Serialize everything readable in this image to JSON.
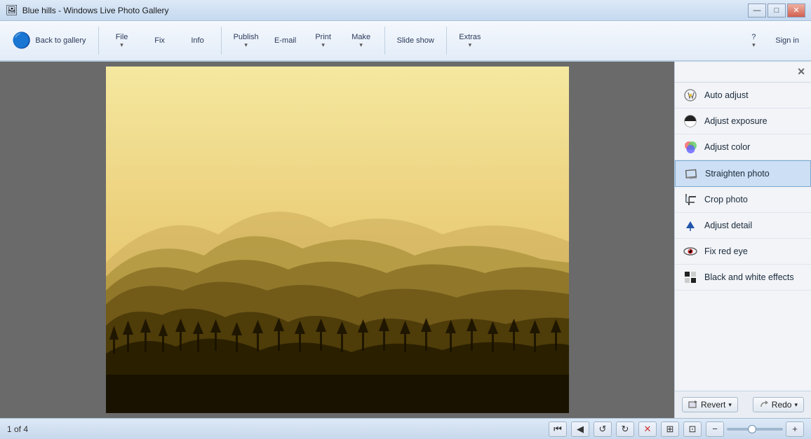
{
  "titlebar": {
    "title": "Blue hills - Windows Live Photo Gallery",
    "icon": "🖼",
    "controls": {
      "minimize": "—",
      "maximize": "□",
      "close": "✕"
    }
  },
  "toolbar": {
    "back_label": "Back to gallery",
    "file_label": "File",
    "fix_label": "Fix",
    "info_label": "Info",
    "publish_label": "Publish",
    "email_label": "E-mail",
    "print_label": "Print",
    "make_label": "Make",
    "slideshow_label": "Slide show",
    "extras_label": "Extras",
    "help_label": "?",
    "signin_label": "Sign in"
  },
  "panel": {
    "close_label": "✕",
    "items": [
      {
        "id": "auto-adjust",
        "label": "Auto adjust",
        "icon": "⚡"
      },
      {
        "id": "adjust-exposure",
        "label": "Adjust exposure",
        "icon": "◑"
      },
      {
        "id": "adjust-color",
        "label": "Adjust color",
        "icon": "🎨"
      },
      {
        "id": "straighten-photo",
        "label": "Straighten photo",
        "icon": "↗"
      },
      {
        "id": "crop-photo",
        "label": "Crop photo",
        "icon": "⊡"
      },
      {
        "id": "adjust-detail",
        "label": "Adjust detail",
        "icon": "▼"
      },
      {
        "id": "fix-red-eye",
        "label": "Fix red eye",
        "icon": "👁"
      },
      {
        "id": "black-white",
        "label": "Black and white effects",
        "icon": "⊞"
      }
    ],
    "footer": {
      "revert_label": "Revert",
      "redo_label": "Redo"
    }
  },
  "bottombar": {
    "photo_count": "1 of 4",
    "nav": {
      "first": "⏮",
      "prev": "◀",
      "ccw": "↺",
      "cw": "↻",
      "delete": "✕",
      "display": "⊞",
      "actual_size": "⊡",
      "zoom_out": "−",
      "zoom_in": "+"
    }
  },
  "photo": {
    "alt": "Blue hills sepia mountain landscape"
  }
}
